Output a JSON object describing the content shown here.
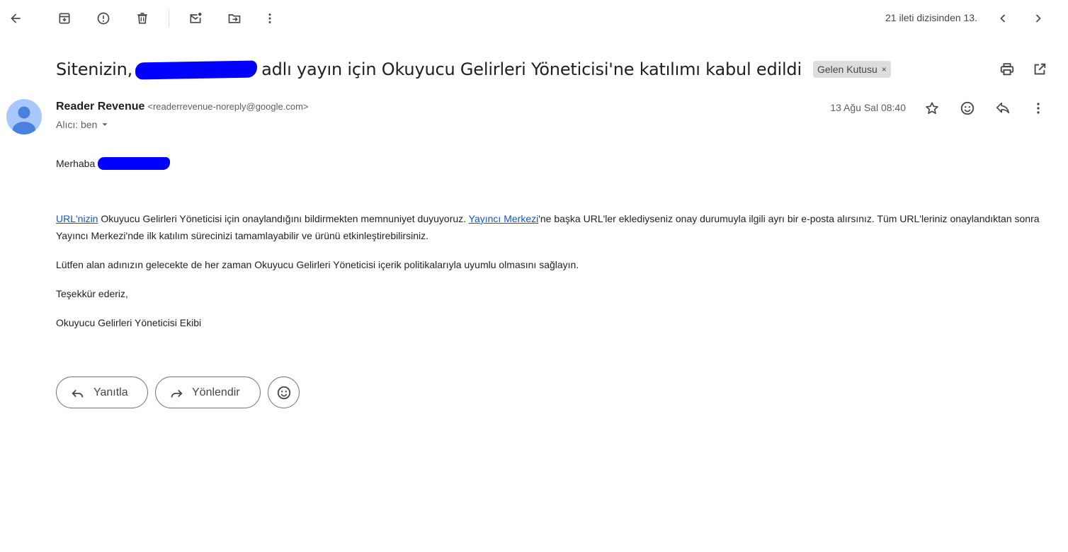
{
  "toolbar": {
    "back_icon": "arrow-back-icon",
    "archive_icon": "archive-icon",
    "spam_icon": "report-spam-icon",
    "delete_icon": "trash-icon",
    "mark_unread_icon": "mark-unread-icon",
    "move_icon": "move-to-icon",
    "more_icon": "more-vert-icon",
    "pager_text": "21 ileti dizisinden 13.",
    "prev_icon": "chevron-left-icon",
    "next_icon": "chevron-right-icon"
  },
  "subject": {
    "before": "Sitenizin,",
    "after": "adlı yayın için Okuyucu Gelirleri Yöneticisi'ne katılımı kabul edildi",
    "label": "Gelen Kutusu",
    "label_remove": "×",
    "print_icon": "print-icon",
    "open_new_window_icon": "open-in-new-icon"
  },
  "message": {
    "sender_name": "Reader Revenue",
    "sender_email": "<readerrevenue-noreply@google.com>",
    "to_label": "Alıcı: ben",
    "date": "13 Ağu Sal 08:40",
    "star_icon": "star-icon",
    "emoji_icon": "emoji-icon",
    "reply_icon": "reply-icon",
    "more_icon": "more-vert-icon"
  },
  "body": {
    "greeting": "Merhaba",
    "p1_link1": "URL'nizin",
    "p1_text1": " Okuyucu Gelirleri Yöneticisi için onaylandığını bildirmekten memnuniyet duyuyoruz. ",
    "p1_link2": "Yayıncı Merkezi",
    "p1_text2": "'ne başka URL'ler eklediyseniz onay durumuyla ilgili ayrı bir e-posta alırsınız. Tüm URL'leriniz onaylandıktan sonra Yayıncı Merkezi'nde ilk katılım sürecinizi tamamlayabilir ve ürünü etkinleştirebilirsiniz.",
    "p2": "Lütfen alan adınızın gelecekte de her zaman Okuyucu Gelirleri Yöneticisi içerik politikalarıyla uyumlu olmasını sağlayın.",
    "p3": "Teşekkür ederiz,",
    "p4": "Okuyucu Gelirleri Yöneticisi Ekibi"
  },
  "actions": {
    "reply_label": "Yanıtla",
    "forward_label": "Yönlendir"
  }
}
